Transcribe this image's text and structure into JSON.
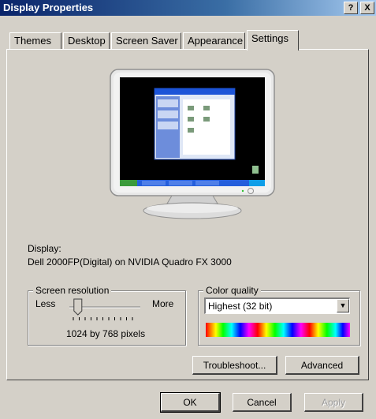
{
  "window": {
    "title": "Display Properties",
    "help_label": "?",
    "close_label": "X"
  },
  "tabs": [
    {
      "label": "Themes",
      "active": false
    },
    {
      "label": "Desktop",
      "active": false
    },
    {
      "label": "Screen Saver",
      "active": false
    },
    {
      "label": "Appearance",
      "active": false
    },
    {
      "label": "Settings",
      "active": true
    }
  ],
  "display": {
    "label": "Display:",
    "value": "Dell 2000FP(Digital) on NVIDIA Quadro FX 3000"
  },
  "resolution": {
    "group_title": "Screen resolution",
    "less_label": "Less",
    "more_label": "More",
    "value_text": "1024 by 768 pixels",
    "slider_position_fraction": 0.12
  },
  "color_quality": {
    "group_title": "Color quality",
    "selected": "Highest (32 bit)"
  },
  "buttons": {
    "troubleshoot": "Troubleshoot...",
    "advanced": "Advanced",
    "ok": "OK",
    "cancel": "Cancel",
    "apply": "Apply"
  },
  "colors": {
    "title_start": "#0a246a",
    "title_end": "#a6caf0",
    "dialog_bg": "#d4d0c8",
    "desktop_blue": "#3a6ea5"
  }
}
